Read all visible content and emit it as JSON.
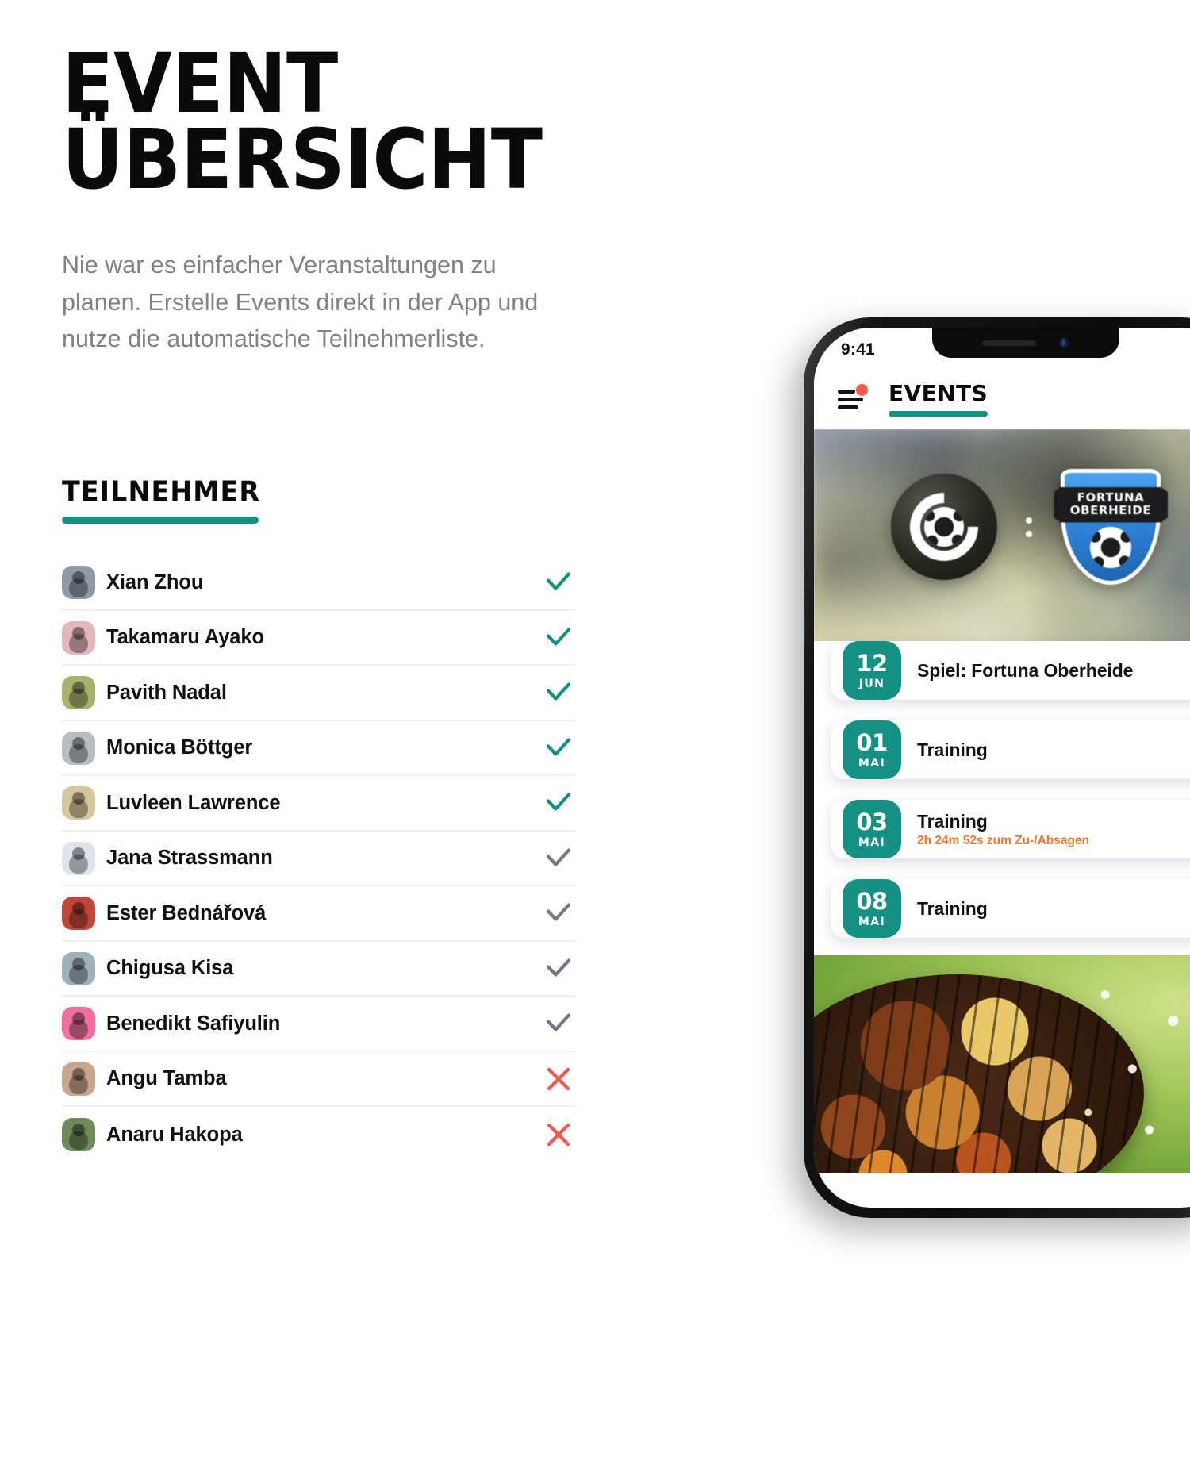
{
  "headline": {
    "line1": "EVENT",
    "line2": "ÜBERSICHT"
  },
  "intro": "Nie war es einfacher Veranstaltungen zu planen. Erstelle Events direkt in der App und nutze die automatische Teilnehmerliste.",
  "participants_section": {
    "title": "TEILNEHMER",
    "rows": [
      {
        "name": "Xian Zhou",
        "status": "accepted"
      },
      {
        "name": "Takamaru Ayako",
        "status": "accepted"
      },
      {
        "name": "Pavith Nadal",
        "status": "accepted"
      },
      {
        "name": "Monica Böttger",
        "status": "accepted"
      },
      {
        "name": "Luvleen Lawrence",
        "status": "accepted"
      },
      {
        "name": "Jana Strassmann",
        "status": "pending"
      },
      {
        "name": "Ester Bednářová",
        "status": "pending"
      },
      {
        "name": "Chigusa Kisa",
        "status": "pending"
      },
      {
        "name": "Benedikt Safiyulin",
        "status": "pending"
      },
      {
        "name": "Angu Tamba",
        "status": "declined"
      },
      {
        "name": "Anaru Hakopa",
        "status": "declined"
      }
    ]
  },
  "phone": {
    "statusbar": {
      "time": "9:41"
    },
    "appbar": {
      "menu_icon": "hamburger-menu-icon",
      "menu_badge": true,
      "title": "EVENTS",
      "search_icon": "search-icon"
    },
    "hero": {
      "home_crest_label": "",
      "separator": ":",
      "away_crest_line1": "FORTUNA",
      "away_crest_line2": "OBERHEIDE"
    },
    "events": [
      {
        "day": "12",
        "month": "JUN",
        "title": "Spiel: Fortuna Oberheide",
        "subtitle": ""
      },
      {
        "day": "01",
        "month": "MAI",
        "title": "Training",
        "subtitle": ""
      },
      {
        "day": "03",
        "month": "MAI",
        "title": "Training",
        "subtitle": "2h 24m 52s zum Zu-/Absagen"
      },
      {
        "day": "08",
        "month": "MAI",
        "title": "Training",
        "subtitle": ""
      }
    ]
  },
  "colors": {
    "accent_teal": "#149183",
    "warning_orange": "#f0762c",
    "declined_red": "#f4584f",
    "pending_gray": "#767687",
    "badge_red": "#fa5a4b",
    "body_gray": "#808184"
  }
}
